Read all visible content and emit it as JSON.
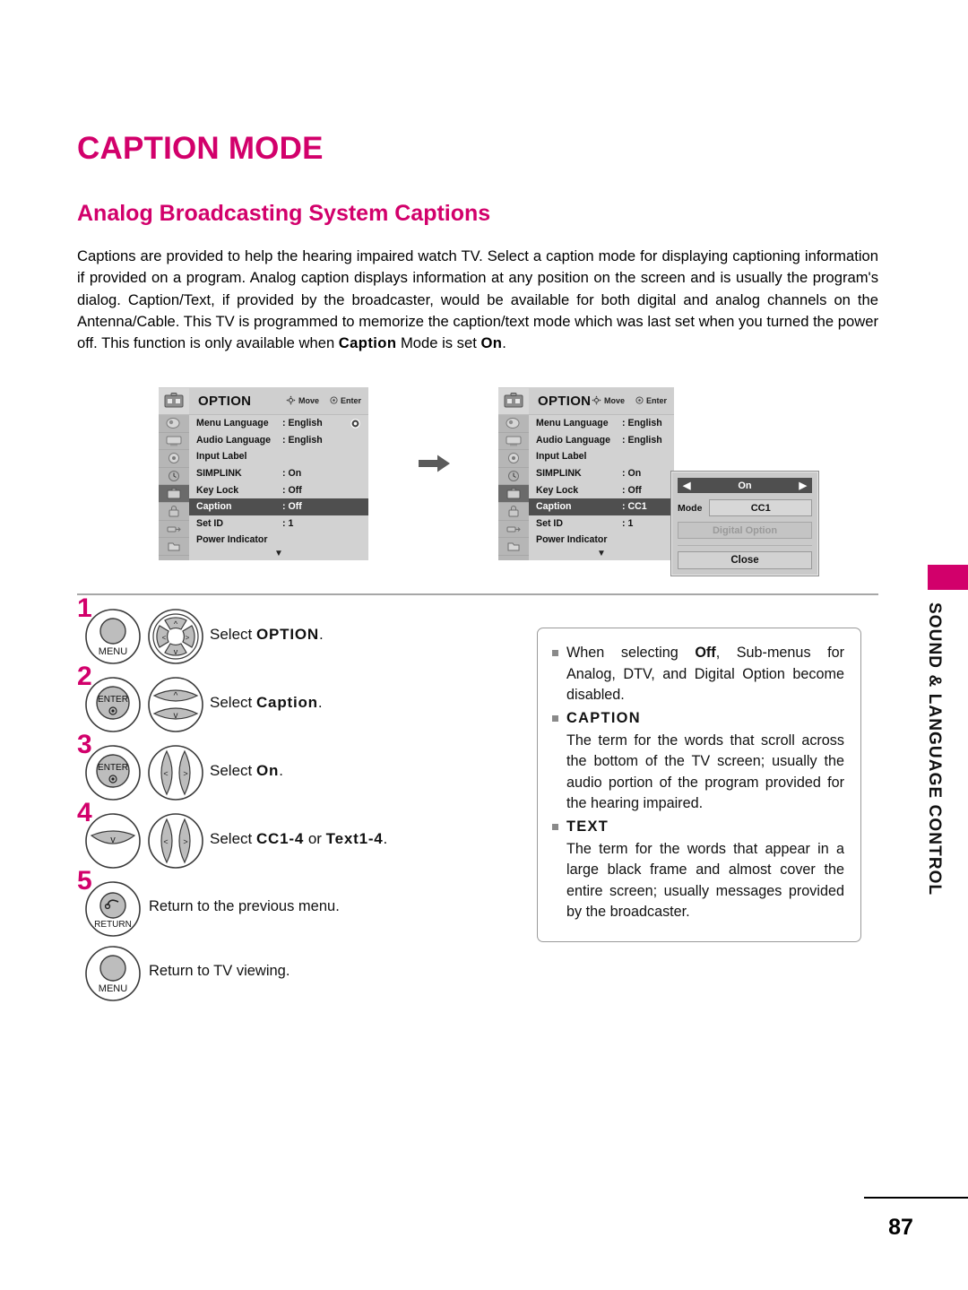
{
  "page": {
    "title": "CAPTION MODE",
    "section_title": "Analog Broadcasting System Captions",
    "intro": "Captions are provided to help the hearing impaired watch TV. Select a caption mode for displaying captioning information if provided on a program. Analog caption displays information at any position on the screen and is usually the program's dialog. Caption/Text, if provided by the broadcaster, would be available for both digital and analog channels on the Antenna/Cable. This TV is programmed to memorize the caption/text mode which was last set when you turned the power off. This function is only available when ",
    "intro_bold_1": "Caption",
    "intro_mid": " Mode is set ",
    "intro_bold_2": "On",
    "intro_end": ".",
    "page_number": "87",
    "accent_color": "#d2006b"
  },
  "sidebar": {
    "label": "SOUND & LANGUAGE CONTROL"
  },
  "osd_before": {
    "header": {
      "title": "OPTION",
      "move_label": "Move",
      "enter_label": "Enter"
    },
    "rows": [
      {
        "label": "Menu Language",
        "value": ": English"
      },
      {
        "label": "Audio Language",
        "value": ": English"
      },
      {
        "label": "Input Label",
        "value": ""
      },
      {
        "label": "SIMPLINK",
        "value": ": On"
      },
      {
        "label": "Key Lock",
        "value": ": Off"
      },
      {
        "label": "Caption",
        "value": ": Off"
      },
      {
        "label": "Set ID",
        "value": ": 1"
      },
      {
        "label": "Power Indicator",
        "value": ""
      }
    ],
    "highlighted_index": 5,
    "scroll_caret": "▼"
  },
  "osd_after": {
    "header": {
      "title": "OPTION",
      "move_label": "Move",
      "enter_label": "Enter"
    },
    "rows": [
      {
        "label": "Menu Language",
        "value": ": English"
      },
      {
        "label": "Audio Language",
        "value": ": English"
      },
      {
        "label": "Input Label",
        "value": ""
      },
      {
        "label": "SIMPLINK",
        "value": ": On"
      },
      {
        "label": "Key Lock",
        "value": ": Off"
      },
      {
        "label": "Caption",
        "value": ": CC1"
      },
      {
        "label": "Set ID",
        "value": ": 1"
      },
      {
        "label": "Power Indicator",
        "value": ""
      }
    ],
    "highlighted_index": 5,
    "scroll_caret": "▼"
  },
  "caption_popup": {
    "state_value": "On",
    "left_arrow": "◀",
    "right_arrow": "▶",
    "mode_label": "Mode",
    "mode_value": "CC1",
    "digital_option_label": "Digital Option",
    "close_label": "Close"
  },
  "steps": [
    {
      "number": "1",
      "button_1": "MENU",
      "button_2": "nav-4way",
      "text_pre": "Select ",
      "text_bold": "OPTION",
      "text_post": "."
    },
    {
      "number": "2",
      "button_1": "ENTER",
      "button_2": "nav-updown",
      "text_pre": "Select ",
      "text_bold": "Caption",
      "text_post": "."
    },
    {
      "number": "3",
      "button_1": "ENTER",
      "button_2": "nav-leftright",
      "text_pre": "Select ",
      "text_bold": "On",
      "text_post": "."
    },
    {
      "number": "4",
      "button_1": "nav-down",
      "button_2": "nav-leftright",
      "text_pre": "Select ",
      "text_bold": "CC1-4",
      "text_mid": " or ",
      "text_bold_2": "Text1-4",
      "text_post": "."
    },
    {
      "number": "5",
      "button_1": "RETURN",
      "button_2": "",
      "text_plain": "Return to the previous menu."
    },
    {
      "number": "",
      "button_1": "MENU",
      "button_2": "",
      "text_plain": "Return to TV viewing."
    }
  ],
  "note_box": {
    "items": [
      {
        "kind": "bullet",
        "text_pre": "When selecting ",
        "text_bold": "Off",
        "text_post": ", Sub-menus for Analog, DTV, and Digital Option become disabled."
      },
      {
        "kind": "heading",
        "heading": "CAPTION",
        "paragraph": "The term for the words that scroll across the bottom of the TV screen; usually the audio portion of the program provided for the hearing impaired."
      },
      {
        "kind": "heading",
        "heading": "TEXT",
        "paragraph": "The term for the words that appear in a large black frame and almost cover the entire screen; usually messages provided by the broadcaster."
      }
    ]
  }
}
